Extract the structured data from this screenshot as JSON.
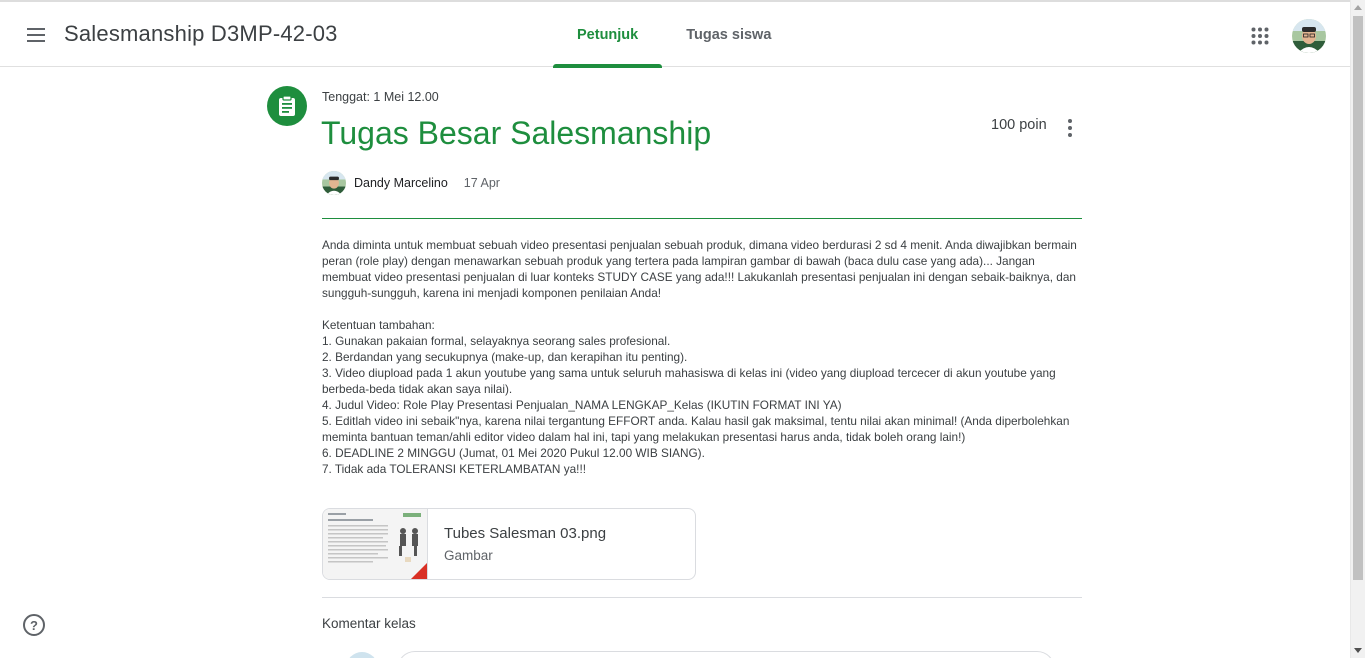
{
  "header": {
    "class_title": "Salesmanship D3MP-42-03",
    "tabs": [
      {
        "label": "Petunjuk",
        "active": true
      },
      {
        "label": "Tugas siswa",
        "active": false
      }
    ]
  },
  "assignment": {
    "due": "Tenggat: 1 Mei 12.00",
    "title": "Tugas Besar Salesmanship",
    "points": "100 poin",
    "author": "Dandy Marcelino",
    "date": "17 Apr",
    "description": "Anda diminta untuk membuat sebuah video presentasi penjualan sebuah produk, dimana video berdurasi 2 sd 4 menit. Anda diwajibkan bermain peran (role play) dengan menawarkan sebuah produk yang tertera pada lampiran gambar di bawah (baca dulu case yang ada)... Jangan membuat video presentasi penjualan di luar konteks STUDY CASE yang ada!!! Lakukanlah presentasi penjualan ini dengan sebaik-baiknya, dan sungguh-sungguh, karena ini menjadi komponen penilaian Anda!\n\nKetentuan tambahan:\n1. Gunakan pakaian formal, selayaknya seorang sales profesional.\n2. Berdandan yang secukupnya (make-up, dan kerapihan itu penting).\n3. Video diupload pada 1 akun youtube yang sama untuk seluruh mahasiswa di kelas ini (video yang diupload tercecer di akun youtube yang berbeda-beda tidak akan saya nilai).\n4. Judul Video: Role Play Presentasi Penjualan_NAMA LENGKAP_Kelas (IKUTIN FORMAT INI YA)\n5. Editlah video ini sebaik\"nya, karena nilai tergantung EFFORT anda. Kalau hasil gak maksimal, tentu nilai akan minimal! (Anda diperbolehkan meminta bantuan teman/ahli editor video dalam hal ini, tapi yang melakukan presentasi harus anda, tidak boleh orang lain!)\n6. DEADLINE 2 MINGGU (Jumat, 01 Mei 2020 Pukul 12.00 WIB SIANG).\n7. Tidak ada TOLERANSI KETERLAMBATAN ya!!!"
  },
  "attachment": {
    "name": "Tubes Salesman 03.png",
    "type": "Gambar"
  },
  "comments": {
    "label": "Komentar kelas"
  },
  "colors": {
    "accent": "#1e8e3e",
    "text": "#3c4043"
  },
  "icons": {
    "menu": "hamburger-menu-icon",
    "apps": "apps-grid-icon",
    "assignment": "assignment-clipboard-icon",
    "more": "more-vert-icon",
    "help": "help-icon"
  }
}
